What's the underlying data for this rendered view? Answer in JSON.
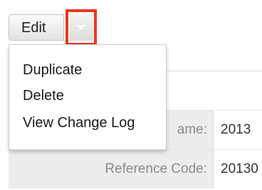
{
  "actions": {
    "edit_label": "Edit",
    "caret_icon": "chevron-down-icon",
    "highlight_color": "#e8391d"
  },
  "dropdown": {
    "items": [
      {
        "label": "Duplicate"
      },
      {
        "label": "Delete"
      },
      {
        "label": "View Change Log"
      }
    ]
  },
  "record": {
    "fields": [
      {
        "label": "ame:",
        "value": "2013"
      },
      {
        "label": "Reference Code:",
        "value": "20130"
      }
    ]
  }
}
